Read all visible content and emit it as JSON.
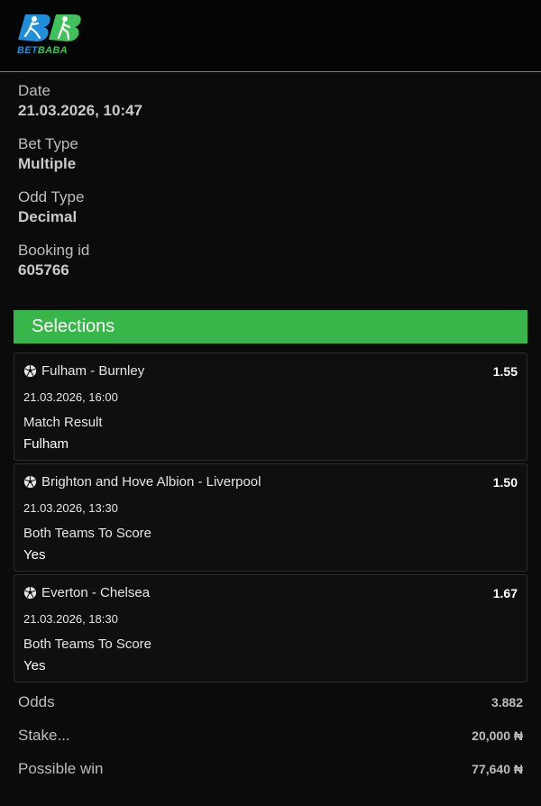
{
  "brand": {
    "logo_text_a": "BET",
    "logo_text_b": "BABA",
    "primary_color": "#1f8fdb",
    "accent_color": "#38b64a"
  },
  "info": [
    {
      "label": "Date",
      "value": "21.03.2026, 10:47"
    },
    {
      "label": "Bet Type",
      "value": "Multiple"
    },
    {
      "label": "Odd Type",
      "value": "Decimal"
    },
    {
      "label": "Booking id",
      "value": "605766"
    }
  ],
  "selections_title": "Selections",
  "selections": [
    {
      "icon": "soccer-ball-icon",
      "match": "Fulham - Burnley",
      "odd": "1.55",
      "date": "21.03.2026, 16:00",
      "market": "Match Result",
      "pick": "Fulham"
    },
    {
      "icon": "soccer-ball-icon",
      "match": "Brighton and Hove Albion - Liverpool",
      "odd": "1.50",
      "date": "21.03.2026, 13:30",
      "market": "Both Teams To Score",
      "pick": "Yes"
    },
    {
      "icon": "soccer-ball-icon",
      "match": "Everton - Chelsea",
      "odd": "1.67",
      "date": "21.03.2026, 18:30",
      "market": "Both Teams To Score",
      "pick": "Yes"
    }
  ],
  "summary": [
    {
      "label": "Odds",
      "value": "3.882"
    },
    {
      "label": "Stake...",
      "value": "20,000 ₦"
    },
    {
      "label": "Possible win",
      "value": "77,640 ₦"
    }
  ]
}
